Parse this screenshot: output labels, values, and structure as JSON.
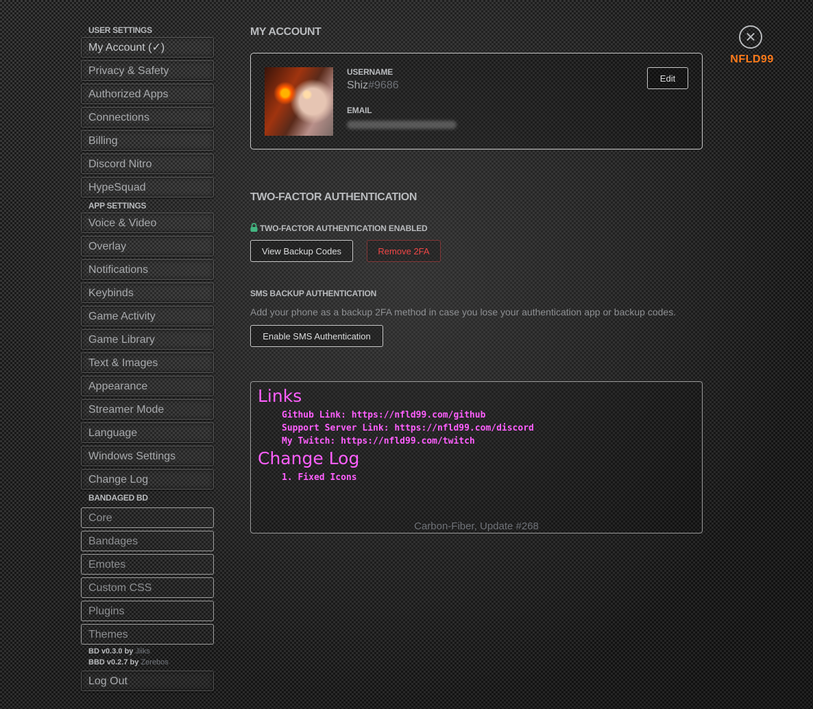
{
  "sidebar": {
    "user_settings_header": "USER SETTINGS",
    "user_items": [
      {
        "label": "My Account (✓)"
      },
      {
        "label": "Privacy & Safety"
      },
      {
        "label": "Authorized Apps"
      },
      {
        "label": "Connections"
      },
      {
        "label": "Billing"
      },
      {
        "label": "Discord Nitro"
      },
      {
        "label": "HypeSquad"
      }
    ],
    "app_settings_header": "APP SETTINGS",
    "app_items": [
      {
        "label": "Voice & Video"
      },
      {
        "label": "Overlay"
      },
      {
        "label": "Notifications"
      },
      {
        "label": "Keybinds"
      },
      {
        "label": "Game Activity"
      },
      {
        "label": "Game Library"
      },
      {
        "label": "Text & Images"
      },
      {
        "label": "Appearance"
      },
      {
        "label": "Streamer Mode"
      },
      {
        "label": "Language"
      },
      {
        "label": "Windows Settings"
      },
      {
        "label": "Change Log"
      }
    ],
    "bd_header": "BANDAGED BD",
    "bd_items": [
      {
        "label": "Core"
      },
      {
        "label": "Bandages"
      },
      {
        "label": "Emotes"
      },
      {
        "label": "Custom CSS"
      },
      {
        "label": "Plugins"
      },
      {
        "label": "Themes"
      }
    ],
    "credits": [
      {
        "version": "BD v0.3.0 by",
        "author": "Jiiks"
      },
      {
        "version": "BBD v0.2.7 by",
        "author": "Zerebos"
      }
    ],
    "logout_label": "Log Out"
  },
  "account": {
    "title": "MY ACCOUNT",
    "username_label": "USERNAME",
    "username": "Shiz",
    "discriminator": "#9686",
    "email_label": "EMAIL",
    "edit_label": "Edit"
  },
  "tfa": {
    "title": "TWO-FACTOR AUTHENTICATION",
    "enabled_label": "TWO-FACTOR AUTHENTICATION ENABLED",
    "view_backup_label": "View Backup Codes",
    "remove_label": "Remove 2FA",
    "sms_title": "SMS BACKUP AUTHENTICATION",
    "sms_desc": "Add your phone as a backup 2FA method in case you lose your authentication app or backup codes.",
    "enable_sms_label": "Enable SMS Authentication"
  },
  "links_box": {
    "links_heading": "Links",
    "links": [
      "Github Link: https://nfld99.com/github",
      "Support Server Link: https://nfld99.com/discord",
      "My Twitch: https://nfld99.com/twitch"
    ],
    "changelog_heading": "Change Log",
    "changelog": [
      "1. Fixed Icons"
    ],
    "footer": "Carbon-Fiber, Update #268"
  },
  "close": {
    "label": "NFLD99"
  },
  "colors": {
    "accent_pink": "#ff5fff",
    "danger": "#f04747",
    "brand_orange": "#ff7a1a",
    "lock_green": "#43b581"
  }
}
